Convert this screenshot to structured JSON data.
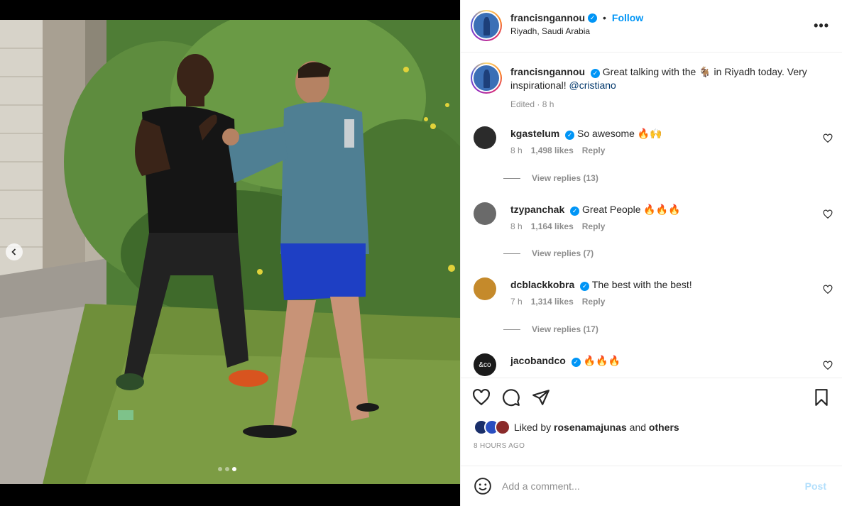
{
  "post": {
    "author": "francisngannou",
    "follow_label": "Follow",
    "separator": "•",
    "location": "Riyadh, Saudi Arabia",
    "more_label": "•••",
    "verified_glyph": "✓",
    "media": {
      "carousel_prev_icon": "chevron-left-icon",
      "slide_count": 3,
      "active_slide": 3
    }
  },
  "caption": {
    "username": "francisngannou",
    "text_before": "Great talking with the",
    "goat_emoji": "🐐",
    "text_after": "in Riyadh today. Very inspirational!",
    "mention": "@cristiano",
    "meta": "Edited · 8 h"
  },
  "comments": [
    {
      "username": "kgastelum",
      "text": "So awesome 🔥🙌",
      "time": "8 h",
      "likes": "1,498 likes",
      "reply": "Reply",
      "view_replies": "View replies (13)",
      "avatar_color": "#2b2b2b"
    },
    {
      "username": "tzypanchak",
      "text": "Great People 🔥🔥🔥",
      "time": "8 h",
      "likes": "1,164 likes",
      "reply": "Reply",
      "view_replies": "View replies (7)",
      "avatar_color": "#6a6a6a"
    },
    {
      "username": "dcblackkobra",
      "text": "The best with the best!",
      "time": "7 h",
      "likes": "1,314 likes",
      "reply": "Reply",
      "view_replies": "View replies (17)",
      "avatar_color": "#c58a2b"
    },
    {
      "username": "jacobandco",
      "text": "🔥🔥🔥",
      "avatar_color": "#1a1a1a",
      "avatar_text": "&co"
    }
  ],
  "actions": {
    "like_icon": "heart-icon",
    "comment_icon": "comment-icon",
    "share_icon": "send-icon",
    "save_icon": "bookmark-icon",
    "liked_prefix": "Liked by",
    "liked_user": "rosenamajunas",
    "liked_conj": "and",
    "liked_others": "others",
    "time_ago": "8 HOURS AGO"
  },
  "add_comment": {
    "placeholder": "Add a comment...",
    "post_label": "Post",
    "emoji_icon": "smiley-icon"
  },
  "colors": {
    "accent": "#0095f6",
    "muted": "#8e8e8e",
    "post_disabled": "#b2dffc"
  }
}
